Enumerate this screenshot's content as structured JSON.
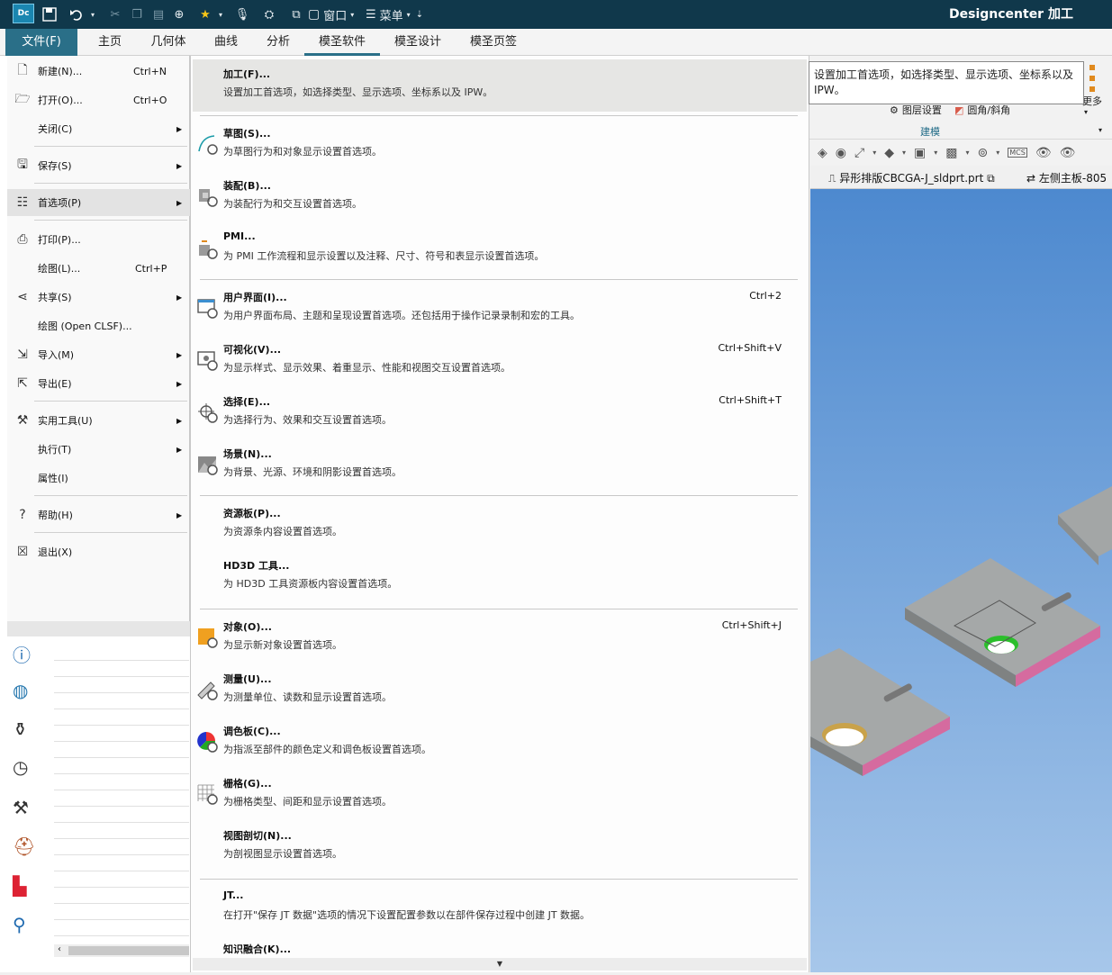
{
  "titlebar": {
    "logo": "Dc",
    "window_label": "窗口",
    "menu_label": "菜单",
    "app_title": "Designcenter  加工"
  },
  "ribbon_tabs": [
    {
      "label": "文件(F)"
    },
    {
      "label": "主页"
    },
    {
      "label": "几何体"
    },
    {
      "label": "曲线"
    },
    {
      "label": "分析"
    },
    {
      "label": "模圣软件"
    },
    {
      "label": "模圣设计"
    },
    {
      "label": "模圣页签"
    }
  ],
  "ribbon_right": {
    "more": "更多",
    "layer_settings": "图层设置",
    "fillet": "圆角/斜角",
    "group": "建模",
    "mcs": "MCS"
  },
  "doc_tabs": [
    {
      "label": "异形排版CBCGA-J_sldprt.prt"
    },
    {
      "label": "左侧主板-805"
    }
  ],
  "file_menu": [
    {
      "label": "新建(N)...",
      "shortcut": "Ctrl+N",
      "icon": "new-file-icon",
      "arrow": false
    },
    {
      "label": "打开(O)...",
      "shortcut": "Ctrl+O",
      "icon": "open-folder-icon",
      "arrow": false
    },
    {
      "label": "关闭(C)",
      "shortcut": "",
      "icon": "",
      "arrow": true
    },
    {
      "label": "保存(S)",
      "shortcut": "",
      "icon": "save-icon",
      "arrow": true
    },
    {
      "label": "首选项(P)",
      "shortcut": "",
      "icon": "preferences-icon",
      "arrow": true
    },
    {
      "label": "打印(P)...",
      "shortcut": "",
      "icon": "print-icon",
      "arrow": false
    },
    {
      "label": "绘图(L)...",
      "shortcut": "Ctrl+P",
      "icon": "",
      "arrow": false
    },
    {
      "label": "共享(S)",
      "shortcut": "",
      "icon": "share-icon",
      "arrow": true
    },
    {
      "label": "绘图 (Open CLSF)...",
      "shortcut": "",
      "icon": "",
      "arrow": false
    },
    {
      "label": "导入(M)",
      "shortcut": "",
      "icon": "import-icon",
      "arrow": true
    },
    {
      "label": "导出(E)",
      "shortcut": "",
      "icon": "export-icon",
      "arrow": true
    },
    {
      "label": "实用工具(U)",
      "shortcut": "",
      "icon": "tools-icon",
      "arrow": true
    },
    {
      "label": "执行(T)",
      "shortcut": "",
      "icon": "",
      "arrow": true
    },
    {
      "label": "属性(I)",
      "shortcut": "",
      "icon": "",
      "arrow": false
    },
    {
      "label": "帮助(H)",
      "shortcut": "",
      "icon": "help-icon",
      "arrow": true
    },
    {
      "label": "退出(X)",
      "shortcut": "",
      "icon": "exit-icon",
      "arrow": false
    }
  ],
  "preferences_menu": [
    {
      "title": "加工(F)...",
      "desc": "设置加工首选项，如选择类型、显示选项、坐标系以及 IPW。",
      "shortcut": "",
      "icon": ""
    },
    {
      "title": "草图(S)...",
      "desc": "为草图行为和对象显示设置首选项。",
      "shortcut": "",
      "icon": "sketch-settings-icon"
    },
    {
      "title": "装配(B)...",
      "desc": "为装配行为和交互设置首选项。",
      "shortcut": "",
      "icon": "assembly-settings-icon"
    },
    {
      "title": "PMI...",
      "desc": "为 PMI 工作流程和显示设置以及注释、尺寸、符号和表显示设置首选项。",
      "shortcut": "",
      "icon": "pmi-settings-icon"
    },
    {
      "title": "用户界面(I)...",
      "desc": "为用户界面布局、主题和呈现设置首选项。还包括用于操作记录录制和宏的工具。",
      "shortcut": "Ctrl+2",
      "icon": "ui-settings-icon"
    },
    {
      "title": "可视化(V)...",
      "desc": "为显示样式、显示效果、着重显示、性能和视图交互设置首选项。",
      "shortcut": "Ctrl+Shift+V",
      "icon": "visualization-settings-icon"
    },
    {
      "title": "选择(E)...",
      "desc": "为选择行为、效果和交互设置首选项。",
      "shortcut": "Ctrl+Shift+T",
      "icon": "selection-settings-icon"
    },
    {
      "title": "场景(N)...",
      "desc": "为背景、光源、环境和阴影设置首选项。",
      "shortcut": "",
      "icon": "scene-settings-icon"
    },
    {
      "title": "资源板(P)...",
      "desc": "为资源条内容设置首选项。",
      "shortcut": "",
      "icon": ""
    },
    {
      "title": "HD3D 工具...",
      "desc": "为 HD3D 工具资源板内容设置首选项。",
      "shortcut": "",
      "icon": ""
    },
    {
      "title": "对象(O)...",
      "desc": "为显示新对象设置首选项。",
      "shortcut": "Ctrl+Shift+J",
      "icon": "object-settings-icon"
    },
    {
      "title": "测量(U)...",
      "desc": "为测量单位、读数和显示设置首选项。",
      "shortcut": "",
      "icon": "measure-settings-icon"
    },
    {
      "title": "调色板(C)...",
      "desc": "为指派至部件的颜色定义和调色板设置首选项。",
      "shortcut": "",
      "icon": "palette-settings-icon"
    },
    {
      "title": "栅格(G)...",
      "desc": "为栅格类型、间距和显示设置首选项。",
      "shortcut": "",
      "icon": "grid-settings-icon"
    },
    {
      "title": "视图剖切(N)...",
      "desc": "为剖视图显示设置首选项。",
      "shortcut": "",
      "icon": ""
    },
    {
      "title": "JT...",
      "desc": "在打开\"保存 JT 数据\"选项的情况下设置配置参数以在部件保存过程中创建 JT 数据。",
      "shortcut": "",
      "icon": ""
    },
    {
      "title": "知识融合(K)...",
      "desc": "",
      "shortcut": "",
      "icon": ""
    }
  ],
  "tooltip": "设置加工首选项，如选择类型、显示选项、坐标系以及 IPW。",
  "colors": {
    "titlebar": "#10384b",
    "accent": "#2a6f88",
    "viewport_top": "#4d89cf",
    "viewport_bottom": "#a7c7ea",
    "part_gray": "#a3a6a6",
    "part_edge": "#d56b9f",
    "hole_green": "#2bbf2b"
  }
}
